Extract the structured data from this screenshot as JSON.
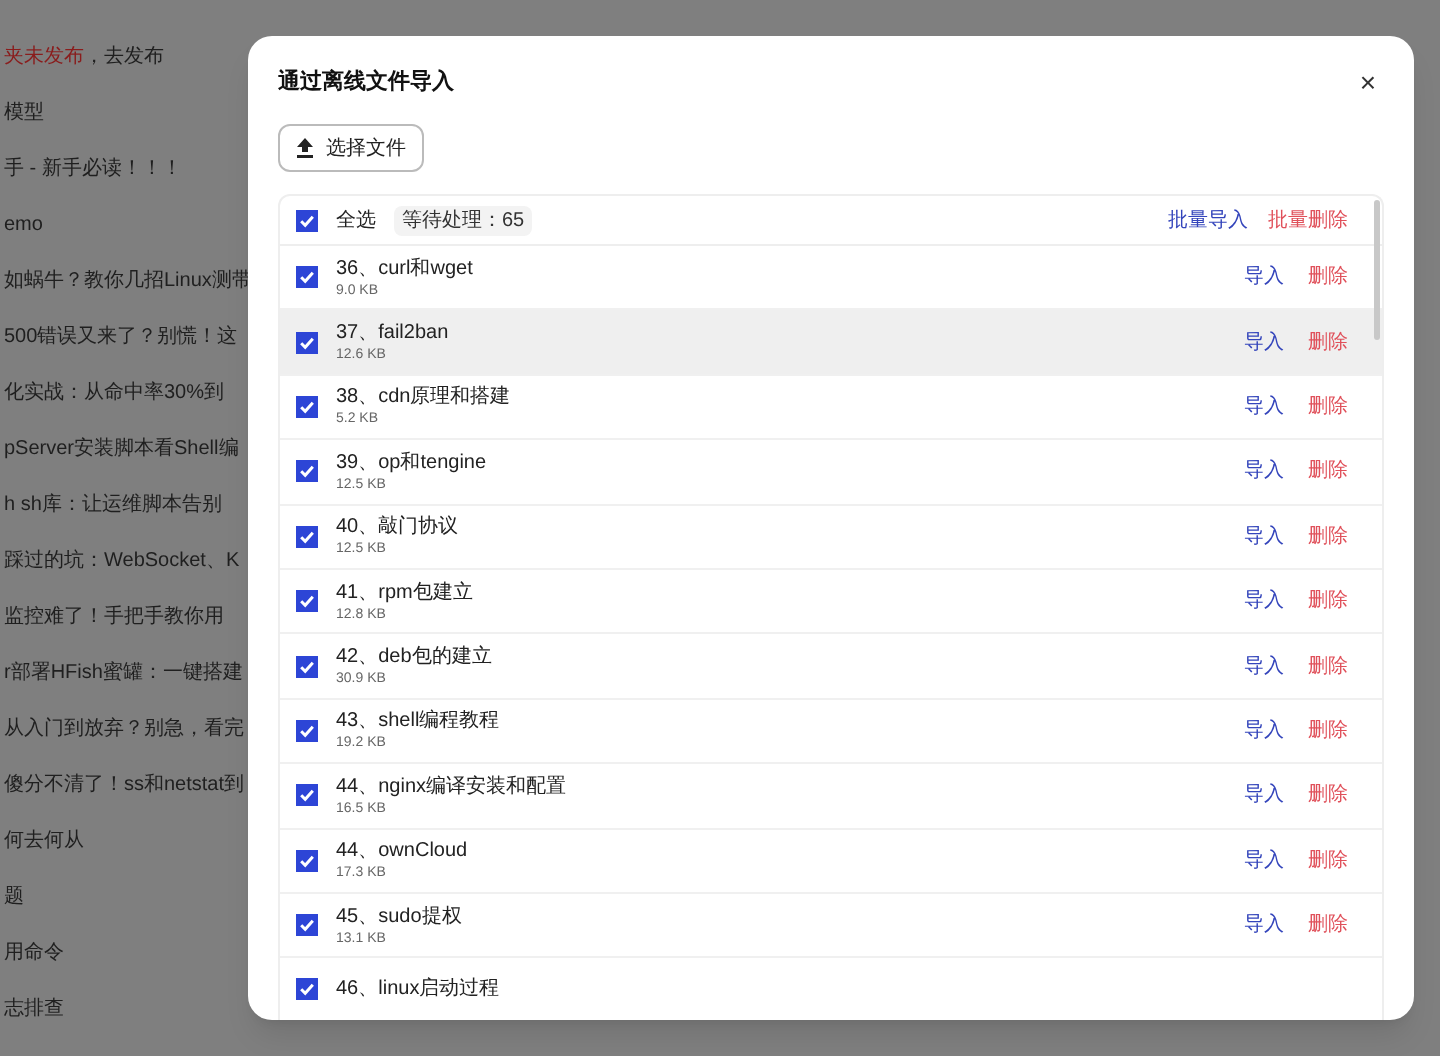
{
  "background_list": [
    {
      "parts": [
        {
          "text": "夹未发布",
          "kind": "alert"
        },
        {
          "text": "，去发布",
          "kind": "normal"
        }
      ]
    },
    {
      "parts": [
        {
          "text": "模型",
          "kind": "normal"
        }
      ]
    },
    {
      "parts": [
        {
          "text": "手 - 新手必读！！！",
          "kind": "normal"
        }
      ]
    },
    {
      "parts": [
        {
          "text": "emo",
          "kind": "normal"
        }
      ]
    },
    {
      "parts": [
        {
          "text": "如蜗牛？教你几招Linux测带",
          "kind": "normal"
        }
      ]
    },
    {
      "parts": [
        {
          "text": "500错误又来了？别慌！这",
          "kind": "normal"
        }
      ]
    },
    {
      "parts": [
        {
          "text": "化实战：从命中率30%到",
          "kind": "normal"
        }
      ]
    },
    {
      "parts": [
        {
          "text": "pServer安装脚本看Shell编",
          "kind": "normal"
        }
      ]
    },
    {
      "parts": [
        {
          "text": "h sh库：让运维脚本告别",
          "kind": "normal"
        }
      ]
    },
    {
      "parts": [
        {
          "text": "踩过的坑：WebSocket、K",
          "kind": "normal"
        }
      ]
    },
    {
      "parts": [
        {
          "text": "监控难了！手把手教你用",
          "kind": "normal"
        }
      ]
    },
    {
      "parts": [
        {
          "text": "r部署HFish蜜罐：一键搭建",
          "kind": "normal"
        }
      ]
    },
    {
      "parts": [
        {
          "text": "从入门到放弃？别急，看完",
          "kind": "normal"
        }
      ]
    },
    {
      "parts": [
        {
          "text": "傻分不清了！ss和netstat到",
          "kind": "normal"
        }
      ]
    },
    {
      "parts": [
        {
          "text": "何去何从",
          "kind": "normal"
        }
      ]
    },
    {
      "parts": [
        {
          "text": "题",
          "kind": "normal"
        }
      ]
    },
    {
      "parts": [
        {
          "text": "用命令",
          "kind": "normal"
        }
      ]
    },
    {
      "parts": [
        {
          "text": "志排查",
          "kind": "normal"
        }
      ]
    }
  ],
  "dialog": {
    "title": "通过离线文件导入",
    "close": "×",
    "choose_button": "选择文件",
    "header": {
      "label": "全选",
      "checked": true,
      "badge": "等待处理：65",
      "batch_import": "批量导入",
      "batch_delete": "批量删除"
    },
    "files": [
      {
        "name": "36、curl和wget",
        "size": "9.0 KB",
        "checked": true,
        "selected": false,
        "import": "导入",
        "delete": "删除"
      },
      {
        "name": "37、fail2ban",
        "size": "12.6 KB",
        "checked": true,
        "selected": true,
        "import": "导入",
        "delete": "删除"
      },
      {
        "name": "38、cdn原理和搭建",
        "size": "5.2 KB",
        "checked": true,
        "selected": false,
        "import": "导入",
        "delete": "删除"
      },
      {
        "name": "39、op和tengine",
        "size": "12.5 KB",
        "checked": true,
        "selected": false,
        "import": "导入",
        "delete": "删除"
      },
      {
        "name": "40、敲门协议",
        "size": "12.5 KB",
        "checked": true,
        "selected": false,
        "import": "导入",
        "delete": "删除"
      },
      {
        "name": "41、rpm包建立",
        "size": "12.8 KB",
        "checked": true,
        "selected": false,
        "import": "导入",
        "delete": "删除"
      },
      {
        "name": "42、deb包的建立",
        "size": "30.9 KB",
        "checked": true,
        "selected": false,
        "import": "导入",
        "delete": "删除"
      },
      {
        "name": "43、shell编程教程",
        "size": "19.2 KB",
        "checked": true,
        "selected": false,
        "import": "导入",
        "delete": "删除"
      },
      {
        "name": "44、nginx编译安装和配置",
        "size": "16.5 KB",
        "checked": true,
        "selected": false,
        "import": "导入",
        "delete": "删除"
      },
      {
        "name": "44、ownCloud",
        "size": "17.3 KB",
        "checked": true,
        "selected": false,
        "import": "导入",
        "delete": "删除"
      },
      {
        "name": "45、sudo提权",
        "size": "13.1 KB",
        "checked": true,
        "selected": false,
        "import": "导入",
        "delete": "删除"
      },
      {
        "name": "46、linux启动过程",
        "checked": true,
        "selected": false
      }
    ]
  }
}
